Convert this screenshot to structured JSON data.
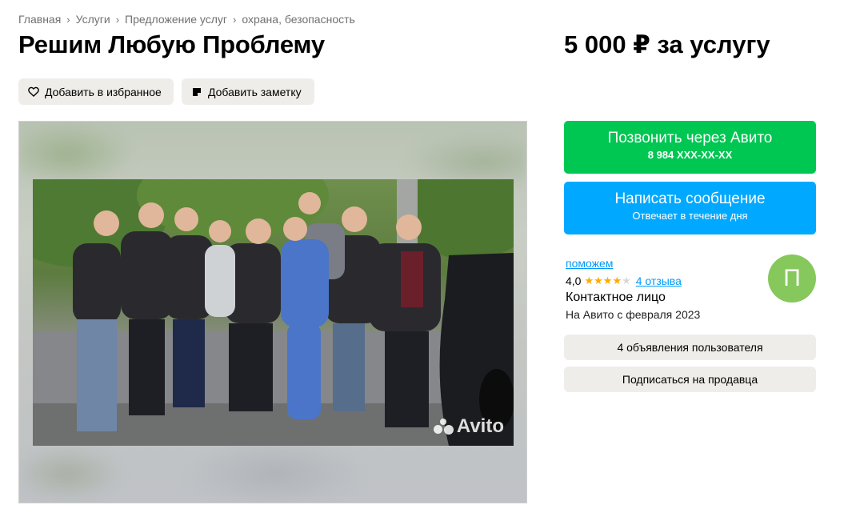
{
  "breadcrumb": [
    "Главная",
    "Услуги",
    "Предложение услуг",
    "охрана, безопасность"
  ],
  "breadcrumb_separator": "›",
  "title": "Решим Любую Проблему",
  "price": "5 000 ₽ за услугу",
  "actions": {
    "favorite_label": "Добавить в избранное",
    "note_label": "Добавить заметку"
  },
  "gallery": {
    "watermark": "Avito"
  },
  "contact": {
    "call_label": "Позвонить через Авито",
    "call_phone": "8 984 XXX-XX-XX",
    "message_label": "Написать сообщение",
    "message_sub": "Отвечает в течение дня"
  },
  "seller": {
    "name": "поможем",
    "rating": "4,0",
    "stars_filled": 4,
    "stars_total": 5,
    "reviews": "4 отзыва",
    "role": "Контактное лицо",
    "since": "На Авито с февраля 2023",
    "avatar_letter": "П",
    "avatar_color": "#86c85c",
    "ads_label": "4 объявления пользователя",
    "subscribe_label": "Подписаться на продавца"
  },
  "colors": {
    "call": "#00c752",
    "message": "#00a9ff",
    "link": "#0099f7",
    "star": "#ffaa00",
    "chip_bg": "#efede9"
  },
  "icons": [
    "chevron-right-icon",
    "heart-icon",
    "note-icon",
    "avito-logo-icon"
  ]
}
